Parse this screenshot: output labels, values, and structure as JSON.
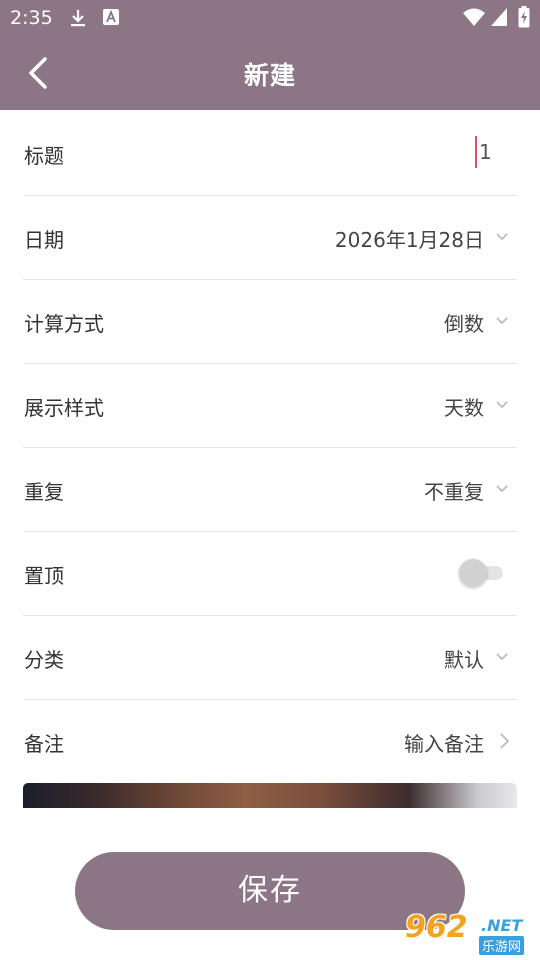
{
  "status_bar": {
    "time": "2:35",
    "icons": [
      "download-icon",
      "a-notification-icon",
      "wifi-icon",
      "signal-icon",
      "battery-charging-icon"
    ]
  },
  "app_bar": {
    "back_icon": "back-arrow-icon",
    "title": "新建"
  },
  "form": {
    "title_row": {
      "label": "标题",
      "value": "1"
    },
    "date_row": {
      "label": "日期",
      "value": "2026年1月28日"
    },
    "calc_row": {
      "label": "计算方式",
      "value": "倒数"
    },
    "display_row": {
      "label": "展示样式",
      "value": "天数"
    },
    "repeat_row": {
      "label": "重复",
      "value": "不重复"
    },
    "pin_row": {
      "label": "置顶",
      "toggle_on": false
    },
    "category_row": {
      "label": "分类",
      "value": "默认"
    },
    "note_row": {
      "label": "备注",
      "placeholder": "输入备注"
    }
  },
  "save_button": {
    "label": "保存"
  },
  "watermark": {
    "number": "962",
    "net": ".NET",
    "cn": "乐游网"
  },
  "colors": {
    "primary": "#8c7685",
    "cursor": "#e0505a",
    "divider": "#e6e6e6"
  }
}
